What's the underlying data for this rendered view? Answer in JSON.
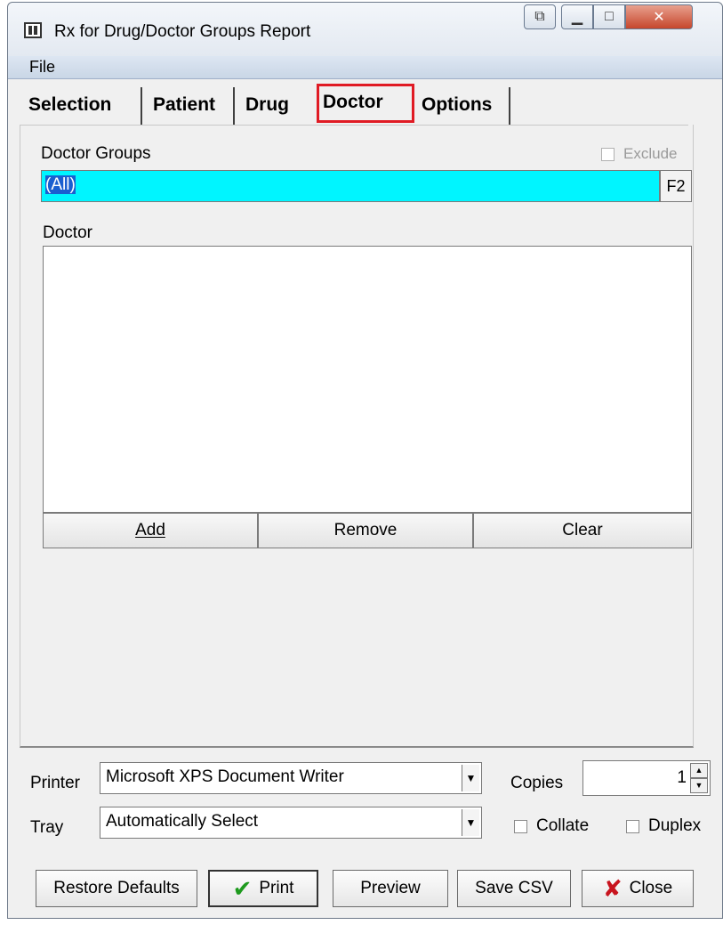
{
  "window": {
    "title": "Rx for Drug/Doctor Groups Report"
  },
  "menu": {
    "file_label": "File"
  },
  "tabs": [
    {
      "label": "Selection",
      "active": false
    },
    {
      "label": "Patient",
      "active": false
    },
    {
      "label": "Drug",
      "active": false
    },
    {
      "label": "Doctor",
      "active": true
    },
    {
      "label": "Options",
      "active": false
    }
  ],
  "doctor_tab": {
    "groups_label": "Doctor Groups",
    "exclude_label": "Exclude",
    "exclude_checked": false,
    "groups_value": "(All)",
    "f2_label": "F2",
    "doctor_label": "Doctor",
    "doctor_items": [],
    "add_label": "Add",
    "remove_label": "Remove",
    "clear_label": "Clear"
  },
  "print": {
    "printer_label": "Printer",
    "printer_value": "Microsoft XPS Document Writer",
    "tray_label": "Tray",
    "tray_value": "Automatically Select",
    "copies_label": "Copies",
    "copies_value": "1",
    "collate_label": "Collate",
    "collate_checked": false,
    "duplex_label": "Duplex",
    "duplex_checked": false
  },
  "buttons": {
    "restore_defaults": "Restore Defaults",
    "print": "Print",
    "preview": "Preview",
    "save_csv": "Save CSV",
    "close": "Close"
  },
  "colors": {
    "highlight_field": "#00f5ff",
    "active_tab_outline": "#e01b24",
    "print_check": "#1e9a1e",
    "close_x": "#c8141e"
  }
}
